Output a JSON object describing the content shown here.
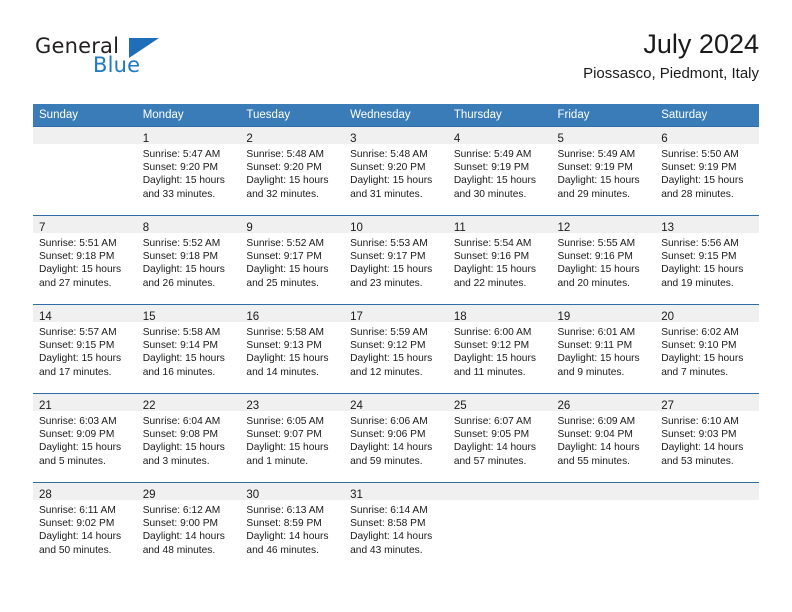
{
  "brand": {
    "name_part1": "General",
    "name_part2": "Blue",
    "triangle_icon": "triangle-icon"
  },
  "header": {
    "title": "July 2024",
    "subtitle": "Piossasco, Piedmont, Italy"
  },
  "colors": {
    "header_blue": "#3a7cb8",
    "row_rule_blue": "#2f6ca8",
    "daynum_bg": "#f0f0f0",
    "brand_blue": "#2079c7"
  },
  "weekdays": [
    "Sunday",
    "Monday",
    "Tuesday",
    "Wednesday",
    "Thursday",
    "Friday",
    "Saturday"
  ],
  "weeks": [
    [
      {
        "day": "",
        "l1": "",
        "l2": "",
        "l3": "",
        "l4": ""
      },
      {
        "day": "1",
        "l1": "Sunrise: 5:47 AM",
        "l2": "Sunset: 9:20 PM",
        "l3": "Daylight: 15 hours",
        "l4": "and 33 minutes."
      },
      {
        "day": "2",
        "l1": "Sunrise: 5:48 AM",
        "l2": "Sunset: 9:20 PM",
        "l3": "Daylight: 15 hours",
        "l4": "and 32 minutes."
      },
      {
        "day": "3",
        "l1": "Sunrise: 5:48 AM",
        "l2": "Sunset: 9:20 PM",
        "l3": "Daylight: 15 hours",
        "l4": "and 31 minutes."
      },
      {
        "day": "4",
        "l1": "Sunrise: 5:49 AM",
        "l2": "Sunset: 9:19 PM",
        "l3": "Daylight: 15 hours",
        "l4": "and 30 minutes."
      },
      {
        "day": "5",
        "l1": "Sunrise: 5:49 AM",
        "l2": "Sunset: 9:19 PM",
        "l3": "Daylight: 15 hours",
        "l4": "and 29 minutes."
      },
      {
        "day": "6",
        "l1": "Sunrise: 5:50 AM",
        "l2": "Sunset: 9:19 PM",
        "l3": "Daylight: 15 hours",
        "l4": "and 28 minutes."
      }
    ],
    [
      {
        "day": "7",
        "l1": "Sunrise: 5:51 AM",
        "l2": "Sunset: 9:18 PM",
        "l3": "Daylight: 15 hours",
        "l4": "and 27 minutes."
      },
      {
        "day": "8",
        "l1": "Sunrise: 5:52 AM",
        "l2": "Sunset: 9:18 PM",
        "l3": "Daylight: 15 hours",
        "l4": "and 26 minutes."
      },
      {
        "day": "9",
        "l1": "Sunrise: 5:52 AM",
        "l2": "Sunset: 9:17 PM",
        "l3": "Daylight: 15 hours",
        "l4": "and 25 minutes."
      },
      {
        "day": "10",
        "l1": "Sunrise: 5:53 AM",
        "l2": "Sunset: 9:17 PM",
        "l3": "Daylight: 15 hours",
        "l4": "and 23 minutes."
      },
      {
        "day": "11",
        "l1": "Sunrise: 5:54 AM",
        "l2": "Sunset: 9:16 PM",
        "l3": "Daylight: 15 hours",
        "l4": "and 22 minutes."
      },
      {
        "day": "12",
        "l1": "Sunrise: 5:55 AM",
        "l2": "Sunset: 9:16 PM",
        "l3": "Daylight: 15 hours",
        "l4": "and 20 minutes."
      },
      {
        "day": "13",
        "l1": "Sunrise: 5:56 AM",
        "l2": "Sunset: 9:15 PM",
        "l3": "Daylight: 15 hours",
        "l4": "and 19 minutes."
      }
    ],
    [
      {
        "day": "14",
        "l1": "Sunrise: 5:57 AM",
        "l2": "Sunset: 9:15 PM",
        "l3": "Daylight: 15 hours",
        "l4": "and 17 minutes."
      },
      {
        "day": "15",
        "l1": "Sunrise: 5:58 AM",
        "l2": "Sunset: 9:14 PM",
        "l3": "Daylight: 15 hours",
        "l4": "and 16 minutes."
      },
      {
        "day": "16",
        "l1": "Sunrise: 5:58 AM",
        "l2": "Sunset: 9:13 PM",
        "l3": "Daylight: 15 hours",
        "l4": "and 14 minutes."
      },
      {
        "day": "17",
        "l1": "Sunrise: 5:59 AM",
        "l2": "Sunset: 9:12 PM",
        "l3": "Daylight: 15 hours",
        "l4": "and 12 minutes."
      },
      {
        "day": "18",
        "l1": "Sunrise: 6:00 AM",
        "l2": "Sunset: 9:12 PM",
        "l3": "Daylight: 15 hours",
        "l4": "and 11 minutes."
      },
      {
        "day": "19",
        "l1": "Sunrise: 6:01 AM",
        "l2": "Sunset: 9:11 PM",
        "l3": "Daylight: 15 hours",
        "l4": "and 9 minutes."
      },
      {
        "day": "20",
        "l1": "Sunrise: 6:02 AM",
        "l2": "Sunset: 9:10 PM",
        "l3": "Daylight: 15 hours",
        "l4": "and 7 minutes."
      }
    ],
    [
      {
        "day": "21",
        "l1": "Sunrise: 6:03 AM",
        "l2": "Sunset: 9:09 PM",
        "l3": "Daylight: 15 hours",
        "l4": "and 5 minutes."
      },
      {
        "day": "22",
        "l1": "Sunrise: 6:04 AM",
        "l2": "Sunset: 9:08 PM",
        "l3": "Daylight: 15 hours",
        "l4": "and 3 minutes."
      },
      {
        "day": "23",
        "l1": "Sunrise: 6:05 AM",
        "l2": "Sunset: 9:07 PM",
        "l3": "Daylight: 15 hours",
        "l4": "and 1 minute."
      },
      {
        "day": "24",
        "l1": "Sunrise: 6:06 AM",
        "l2": "Sunset: 9:06 PM",
        "l3": "Daylight: 14 hours",
        "l4": "and 59 minutes."
      },
      {
        "day": "25",
        "l1": "Sunrise: 6:07 AM",
        "l2": "Sunset: 9:05 PM",
        "l3": "Daylight: 14 hours",
        "l4": "and 57 minutes."
      },
      {
        "day": "26",
        "l1": "Sunrise: 6:09 AM",
        "l2": "Sunset: 9:04 PM",
        "l3": "Daylight: 14 hours",
        "l4": "and 55 minutes."
      },
      {
        "day": "27",
        "l1": "Sunrise: 6:10 AM",
        "l2": "Sunset: 9:03 PM",
        "l3": "Daylight: 14 hours",
        "l4": "and 53 minutes."
      }
    ],
    [
      {
        "day": "28",
        "l1": "Sunrise: 6:11 AM",
        "l2": "Sunset: 9:02 PM",
        "l3": "Daylight: 14 hours",
        "l4": "and 50 minutes."
      },
      {
        "day": "29",
        "l1": "Sunrise: 6:12 AM",
        "l2": "Sunset: 9:00 PM",
        "l3": "Daylight: 14 hours",
        "l4": "and 48 minutes."
      },
      {
        "day": "30",
        "l1": "Sunrise: 6:13 AM",
        "l2": "Sunset: 8:59 PM",
        "l3": "Daylight: 14 hours",
        "l4": "and 46 minutes."
      },
      {
        "day": "31",
        "l1": "Sunrise: 6:14 AM",
        "l2": "Sunset: 8:58 PM",
        "l3": "Daylight: 14 hours",
        "l4": "and 43 minutes."
      },
      {
        "day": "",
        "l1": "",
        "l2": "",
        "l3": "",
        "l4": ""
      },
      {
        "day": "",
        "l1": "",
        "l2": "",
        "l3": "",
        "l4": ""
      },
      {
        "day": "",
        "l1": "",
        "l2": "",
        "l3": "",
        "l4": ""
      }
    ]
  ]
}
